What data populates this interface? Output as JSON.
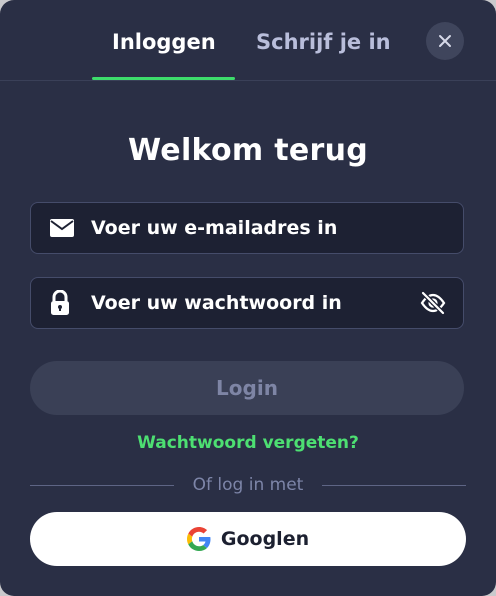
{
  "tabs": {
    "login_label": "Inloggen",
    "signup_label": "Schrijf je in",
    "active": "login"
  },
  "title": "Welkom terug",
  "email_field": {
    "placeholder": "Voer uw e-mailadres in",
    "value": "",
    "icon": "envelope-icon"
  },
  "password_field": {
    "placeholder": "Voer uw wachtwoord in",
    "value": "",
    "icon": "lock-icon",
    "toggle_icon": "eye-off-icon"
  },
  "login_button": {
    "label": "Login"
  },
  "forgot_link": {
    "label": "Wachtwoord vergeten?"
  },
  "divider": {
    "label": "Of log in met"
  },
  "google_button": {
    "label": "Googlen",
    "icon": "google-icon"
  },
  "colors": {
    "background": "#2a2f45",
    "input_background": "#1d2133",
    "accent_green": "#3ddc6b",
    "disabled_button": "#3a4056",
    "white": "#ffffff"
  }
}
